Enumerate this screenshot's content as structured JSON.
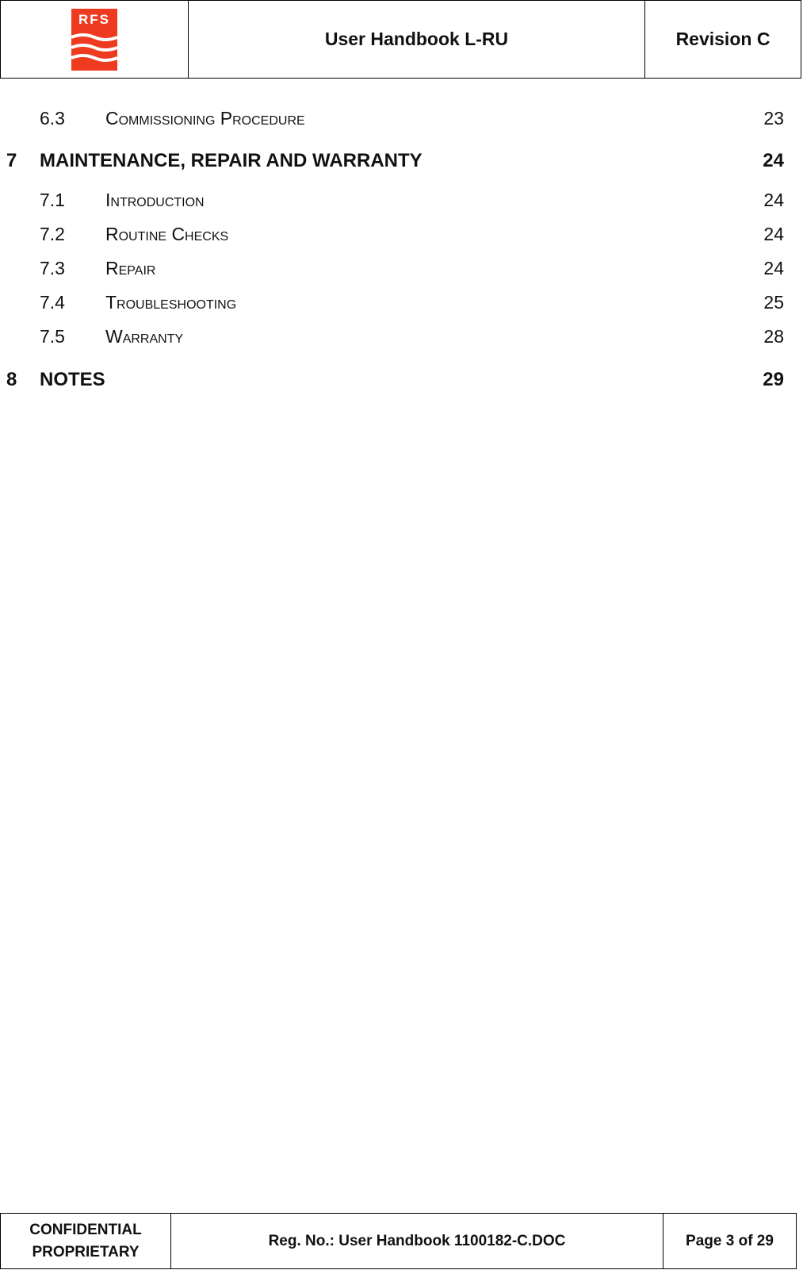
{
  "header": {
    "logo_text": "RFS",
    "title": "User Handbook L-RU",
    "revision": "Revision C",
    "brand_color": "#ee3a1f"
  },
  "toc": [
    {
      "level": "sub",
      "number": "6.3",
      "title": "Commissioning Procedure",
      "page": "23"
    },
    {
      "level": "main",
      "number": "7",
      "title": "MAINTENANCE, REPAIR AND WARRANTY",
      "page": "24"
    },
    {
      "level": "sub",
      "number": "7.1",
      "title": "Introduction",
      "page": "24"
    },
    {
      "level": "sub",
      "number": "7.2",
      "title": "Routine Checks",
      "page": "24"
    },
    {
      "level": "sub",
      "number": "7.3",
      "title": "Repair",
      "page": "24"
    },
    {
      "level": "sub",
      "number": "7.4",
      "title": "Troubleshooting",
      "page": "25"
    },
    {
      "level": "sub",
      "number": "7.5",
      "title": "Warranty",
      "page": "28"
    },
    {
      "level": "main",
      "number": "8",
      "title": "NOTES",
      "page": "29"
    }
  ],
  "footer": {
    "classification_line1": "CONFIDENTIAL",
    "classification_line2": "PROPRIETARY",
    "reg_no": "Reg. No.: User Handbook 1100182-C.DOC",
    "page_info": "Page 3 of 29"
  }
}
